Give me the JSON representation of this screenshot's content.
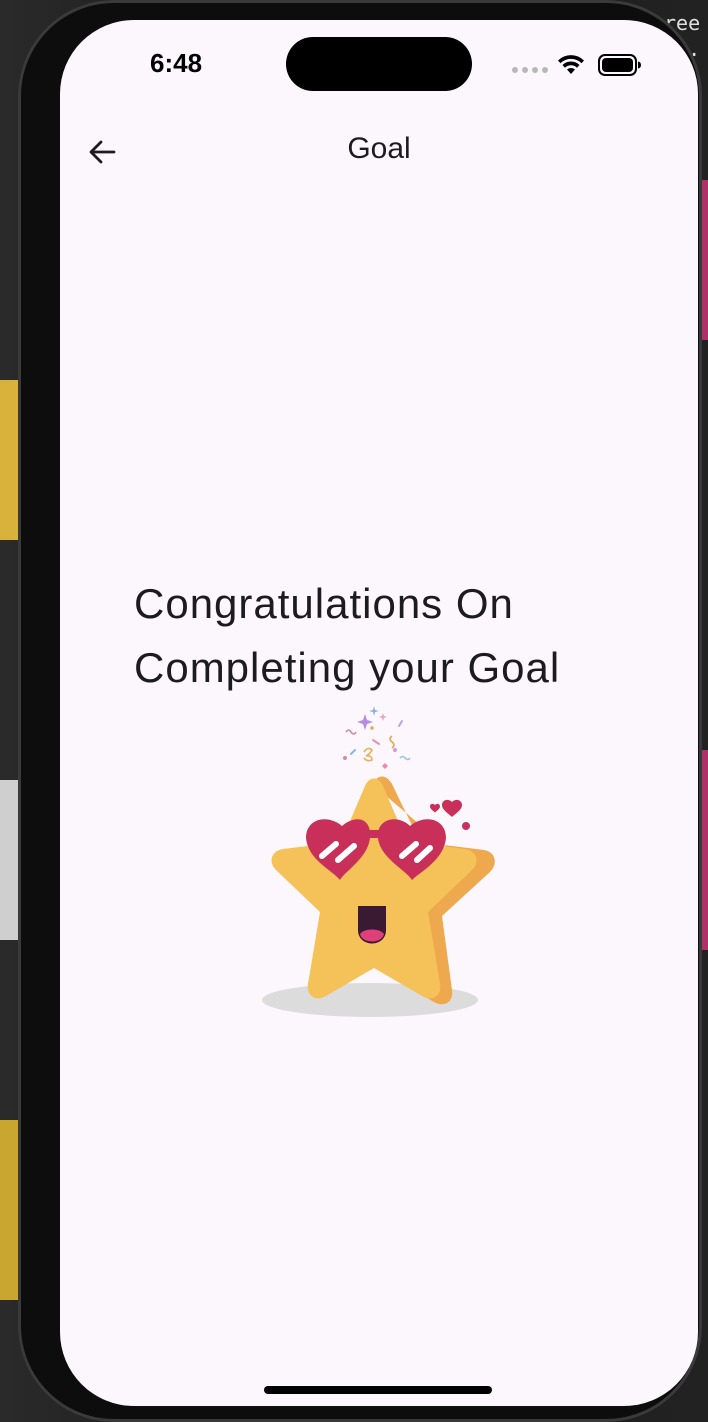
{
  "status_bar": {
    "time": "6:48",
    "icons": [
      "signal-dots-icon",
      "wifi-icon",
      "battery-icon"
    ]
  },
  "app_bar": {
    "back_icon": "arrow-left-icon",
    "title": "Goal"
  },
  "content": {
    "headline_line1": "Congratulations On",
    "headline_line2": "Completing your Goal",
    "illustration": "celebrating-star-with-heart-sunglasses"
  },
  "backdrop": {
    "corner_text_line1": "ree",
    "corner_text_line2": "?.."
  },
  "colors": {
    "screen_background": "#fcf7fc",
    "text": "#1d1b20",
    "star": "#f5c25a",
    "star_shade": "#eea94f",
    "glasses": "#c8305a"
  }
}
